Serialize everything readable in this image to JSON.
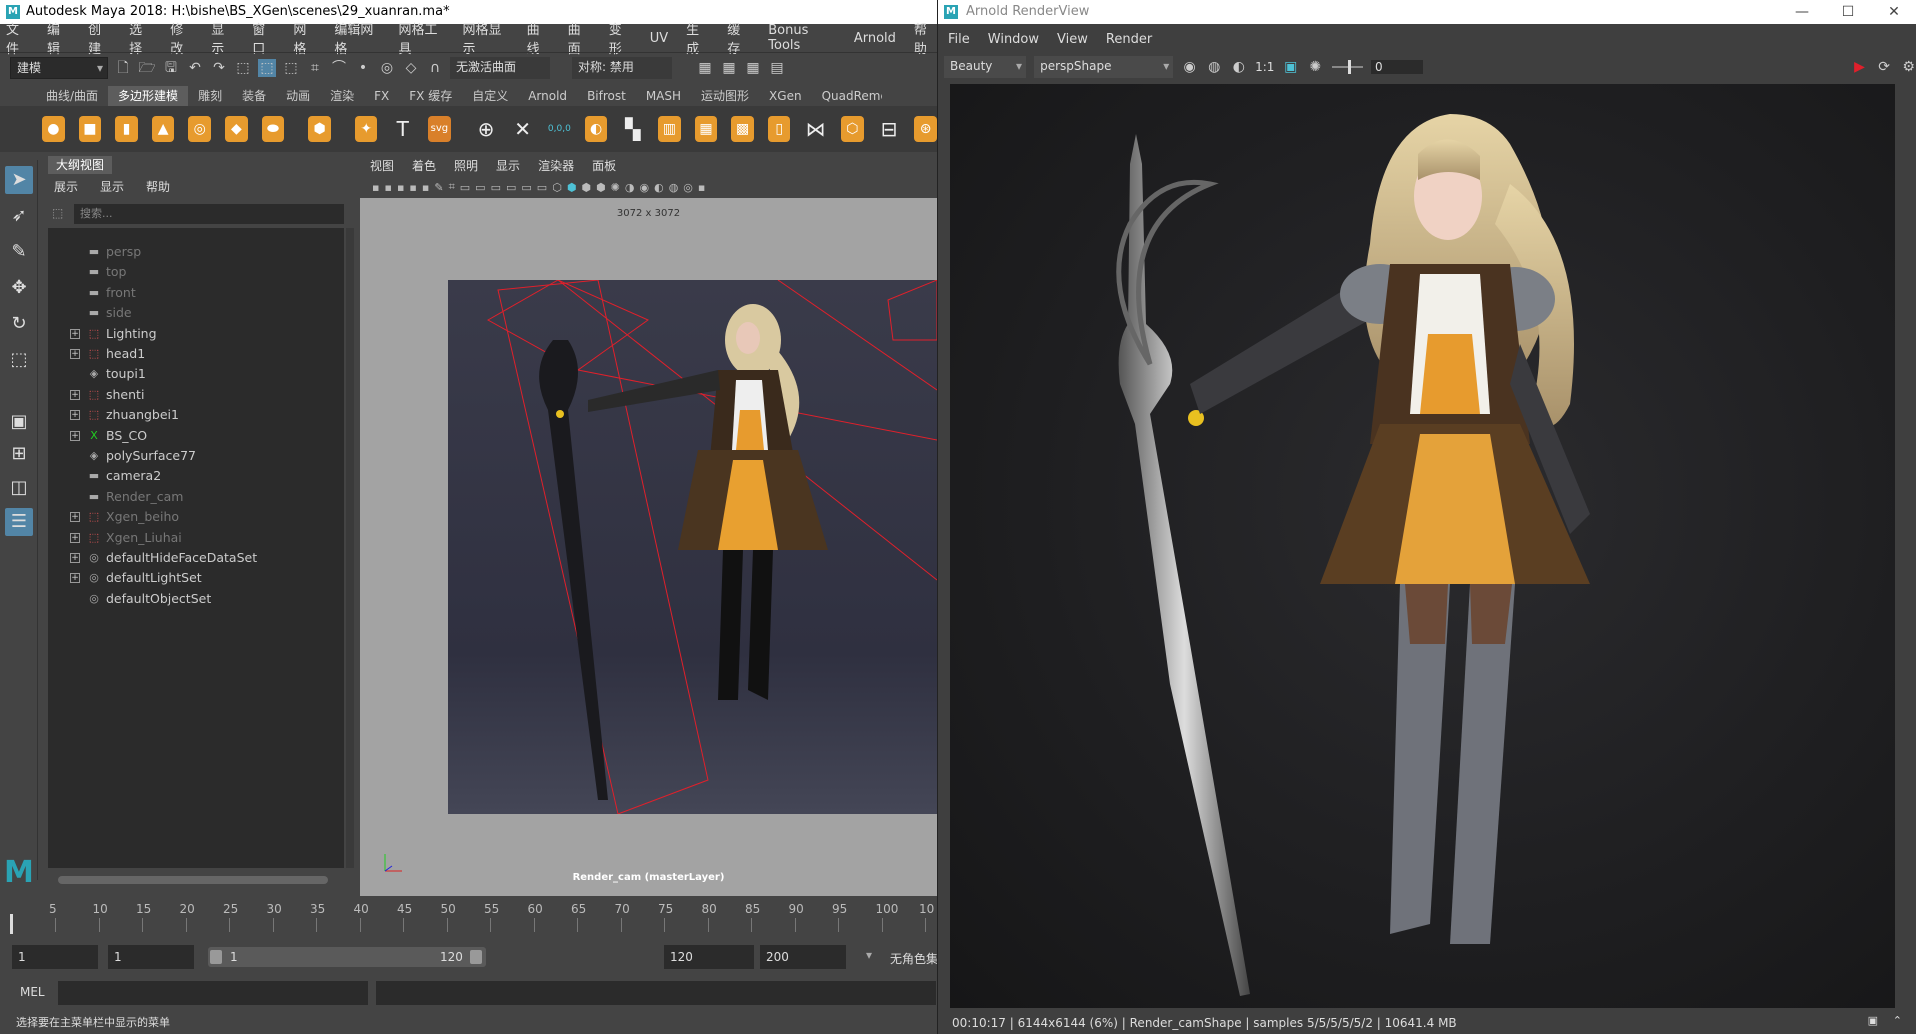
{
  "maya": {
    "title": "Autodesk Maya 2018: H:\\bishe\\BS_XGen\\scenes\\29_xuanran.ma*",
    "menu": [
      "文件",
      "编辑",
      "创建",
      "选择",
      "修改",
      "显示",
      "窗口",
      "网格",
      "编辑网格",
      "网格工具",
      "网格显示",
      "曲线",
      "曲面",
      "变形",
      "UV",
      "生成",
      "缓存",
      "Bonus Tools",
      "Arnold",
      "帮助"
    ],
    "toolbar": {
      "mode": "建模",
      "live_surface": "无激活曲面",
      "symmetry": "对称: 禁用"
    },
    "shelf_tabs": [
      "曲线/曲面",
      "多边形建模",
      "雕刻",
      "装备",
      "动画",
      "渲染",
      "FX",
      "FX 缓存",
      "自定义",
      "Arnold",
      "Bifrost",
      "MASH",
      "运动图形",
      "XGen",
      "QuadRemesher"
    ],
    "shelf_active": "多边形建模",
    "shelf_icons": [
      "sphere-icon",
      "cube-icon",
      "cylinder-icon",
      "cone-icon",
      "torus-icon",
      "plane-icon",
      "disc-icon",
      "platonic-icon",
      "star-icon",
      "text-icon",
      "svg-icon",
      "combine-icon",
      "separate-icon",
      "bevel-icon"
    ],
    "shelf_text": {
      "text": "T",
      "svg": "svg",
      "coords": "0,0,0"
    },
    "outliner": {
      "title": "大纲视图",
      "menu": [
        "展示",
        "显示",
        "帮助"
      ],
      "search_placeholder": "搜索...",
      "items": [
        {
          "label": "persp",
          "icon": "camera",
          "dim": true,
          "expand": false
        },
        {
          "label": "top",
          "icon": "camera",
          "dim": true,
          "expand": false
        },
        {
          "label": "front",
          "icon": "camera",
          "dim": true,
          "expand": false
        },
        {
          "label": "side",
          "icon": "camera",
          "dim": true,
          "expand": false
        },
        {
          "label": "Lighting",
          "icon": "group",
          "dim": false,
          "expand": true
        },
        {
          "label": "head1",
          "icon": "group",
          "dim": false,
          "expand": true
        },
        {
          "label": "toupi1",
          "icon": "mesh",
          "dim": false,
          "expand": false
        },
        {
          "label": "shenti",
          "icon": "group",
          "dim": false,
          "expand": true
        },
        {
          "label": "zhuangbei1",
          "icon": "group",
          "dim": false,
          "expand": true
        },
        {
          "label": "BS_CO",
          "icon": "xgen",
          "dim": false,
          "expand": true
        },
        {
          "label": "polySurface77",
          "icon": "mesh",
          "dim": false,
          "expand": false
        },
        {
          "label": "camera2",
          "icon": "camera",
          "dim": false,
          "expand": false
        },
        {
          "label": "Render_cam",
          "icon": "camera",
          "dim": true,
          "expand": false
        },
        {
          "label": "Xgen_beiho",
          "icon": "group",
          "dim": true,
          "expand": true
        },
        {
          "label": "Xgen_Liuhai",
          "icon": "group",
          "dim": true,
          "expand": true
        },
        {
          "label": "defaultHideFaceDataSet",
          "icon": "set",
          "dim": false,
          "expand": true
        },
        {
          "label": "defaultLightSet",
          "icon": "set",
          "dim": false,
          "expand": true
        },
        {
          "label": "defaultObjectSet",
          "icon": "set",
          "dim": false,
          "expand": false
        }
      ]
    },
    "viewport": {
      "menu": [
        "视图",
        "着色",
        "照明",
        "显示",
        "渲染器",
        "面板"
      ],
      "resolution": "3072 x 3072",
      "camera_label": "Render_cam (masterLayer)"
    },
    "timeline": {
      "ticks": [
        "5",
        "10",
        "15",
        "20",
        "25",
        "30",
        "35",
        "40",
        "45",
        "50",
        "55",
        "60",
        "65",
        "70",
        "75",
        "80",
        "85",
        "90",
        "95",
        "100",
        "10"
      ],
      "current_frame": "1",
      "start": "1",
      "range_start": "1",
      "range_end": "120",
      "end": "120",
      "anim_end": "200",
      "char_set": "无角色集"
    },
    "mel_label": "MEL",
    "status": "选择要在主菜单栏中显示的菜单"
  },
  "arnold": {
    "title": "Arnold RenderView",
    "menu": [
      "File",
      "Window",
      "View",
      "Render"
    ],
    "aov": "Beauty",
    "camera": "perspShape",
    "ratio": "1:1",
    "exposure": "0",
    "status": "00:10:17 | 6144x6144 (6%) | Render_camShape  | samples 5/5/5/5/5/2 | 10641.4 MB"
  },
  "colors": {
    "accent": "#e79b2e",
    "maya_teal": "#2aa3b4",
    "selected": "#5285a6",
    "render_red": "#e0202b"
  }
}
